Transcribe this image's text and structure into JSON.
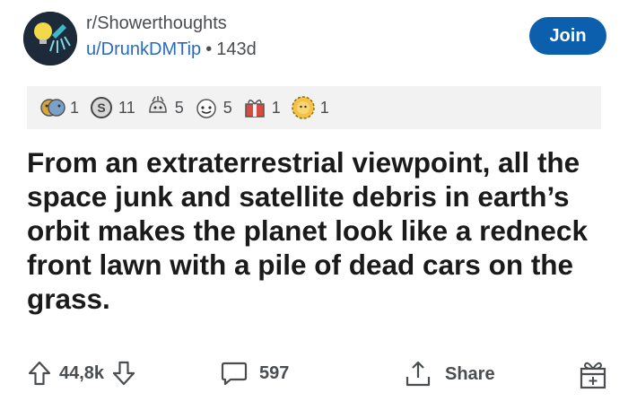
{
  "header": {
    "subreddit": "r/Showerthoughts",
    "username": "u/DrunkDMTip",
    "separator": "•",
    "age": "143d",
    "join_label": "Join"
  },
  "awards": [
    {
      "icon": "gold-faces-award-icon",
      "count": "1"
    },
    {
      "icon": "silver-coin-award-icon",
      "count": "11"
    },
    {
      "icon": "mind-blown-award-icon",
      "count": "5"
    },
    {
      "icon": "snoo-face-award-icon",
      "count": "5"
    },
    {
      "icon": "gift-box-award-icon",
      "count": "1"
    },
    {
      "icon": "gold-sun-award-icon",
      "count": "1"
    }
  ],
  "post": {
    "title": "From an extraterrestrial viewpoint, all the space junk and satellite debris in earth’s orbit makes the planet look like a redneck front lawn with a pile of dead cars on the grass."
  },
  "footer": {
    "score": "44,8k",
    "comments": "597",
    "share_label": "Share"
  },
  "colors": {
    "join_bg": "#0b5fad",
    "link": "#2a6bb8",
    "muted": "#4a4d50",
    "award_bar": "#f2f2f2"
  }
}
